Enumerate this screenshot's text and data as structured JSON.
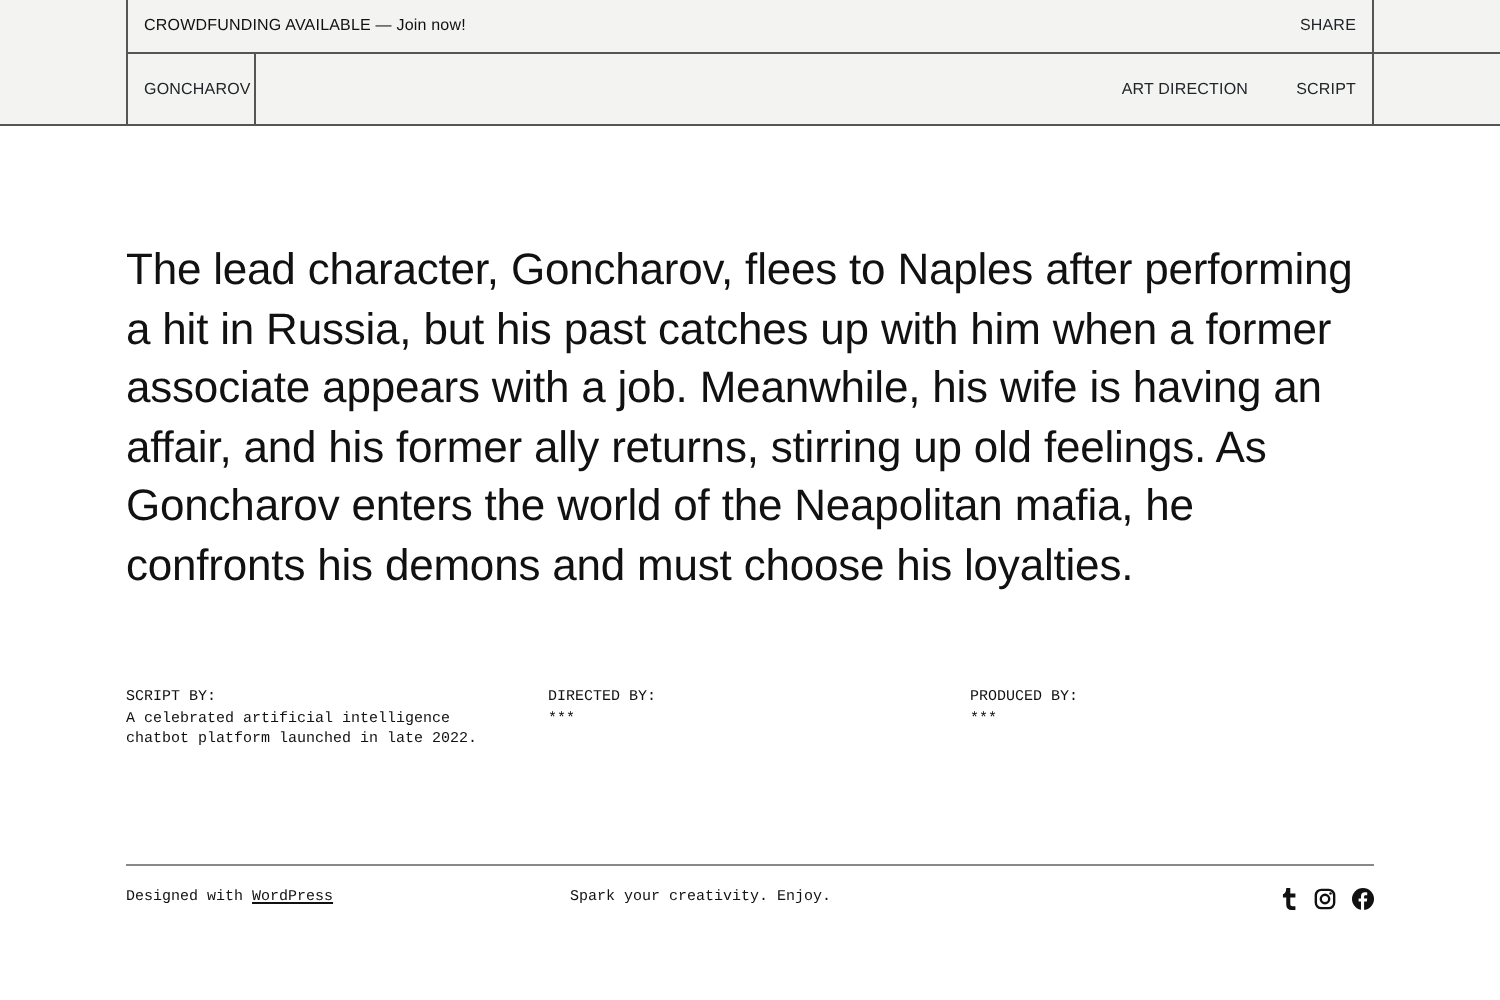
{
  "banner": {
    "text": "CROWDFUNDING AVAILABLE — Join now!",
    "share": "SHARE"
  },
  "site": {
    "title": "GONCHAROV",
    "nav": [
      "ART DIRECTION",
      "SCRIPT"
    ]
  },
  "synopsis": "The lead character, Goncharov, flees to Naples after performing a hit in Russia, but his past catches up with him when a former associate appears with a job. Meanwhile, his wife is having an affair, and his former ally returns, stirring up old feelings. As Goncharov enters the world of the Neapolitan mafia, he confronts his demons and must choose his loyalties.",
  "credits": [
    {
      "label": "SCRIPT BY:",
      "value": "A celebrated artificial intelligence chatbot platform launched in late 2022."
    },
    {
      "label": "DIRECTED BY:",
      "value": "***"
    },
    {
      "label": "PRODUCED BY:",
      "value": "***"
    }
  ],
  "footer": {
    "credit_prefix": "Designed with",
    "credit_link": "WordPress",
    "tagline": "Spark your creativity. Enjoy.",
    "social": [
      {
        "kind": "tumblr"
      },
      {
        "kind": "instagram"
      },
      {
        "kind": "facebook"
      }
    ]
  }
}
